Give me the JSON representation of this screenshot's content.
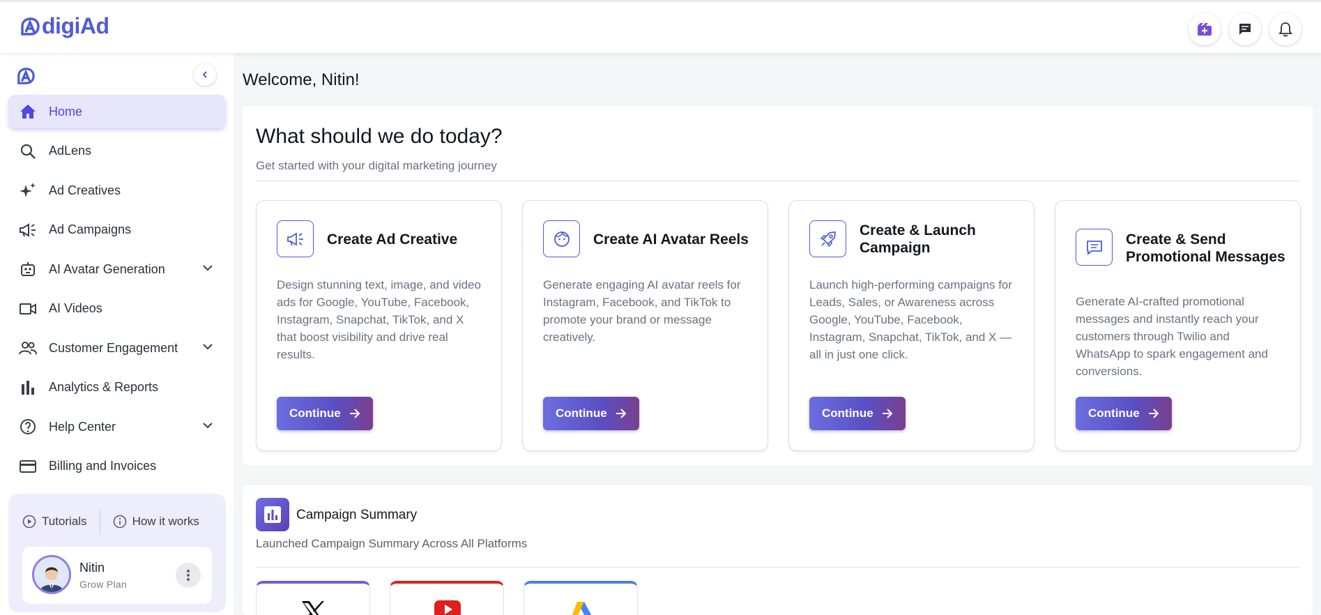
{
  "header": {
    "logo_text": "digiAd",
    "brand_color": "#4f5bd5",
    "icons": [
      "video-add-icon",
      "chat-icon",
      "bell-icon"
    ]
  },
  "sidebar": {
    "items": [
      {
        "label": "Home",
        "icon": "home-icon",
        "active": true
      },
      {
        "label": "AdLens",
        "icon": "search-icon"
      },
      {
        "label": "Ad Creatives",
        "icon": "sparkle-icon"
      },
      {
        "label": "Ad Campaigns",
        "icon": "megaphone-icon"
      },
      {
        "label": "AI Avatar Generation",
        "icon": "robot-icon",
        "expandable": true
      },
      {
        "label": "AI Videos",
        "icon": "video-icon"
      },
      {
        "label": "Customer Engagement",
        "icon": "people-icon",
        "expandable": true
      },
      {
        "label": "Analytics & Reports",
        "icon": "bar-chart-icon"
      },
      {
        "label": "Help Center",
        "icon": "help-icon",
        "expandable": true
      },
      {
        "label": "Billing and Invoices",
        "icon": "card-icon"
      }
    ],
    "tutorials_label": "Tutorials",
    "how_it_works_label": "How it works",
    "user": {
      "name": "Nitin",
      "plan": "Grow Plan"
    }
  },
  "main": {
    "welcome": "Welcome, Nitin!",
    "panel_title": "What should we do today?",
    "panel_subtitle": "Get started with your digital marketing journey",
    "cards": [
      {
        "title": "Create Ad Creative",
        "icon": "megaphone-icon",
        "desc": "Design stunning text, image, and video ads for Google, YouTube, Facebook, Instagram, Snapchat, TikTok, and X that boost visibility and drive real results.",
        "button": "Continue"
      },
      {
        "title": "Create AI Avatar Reels",
        "icon": "face-icon",
        "desc": "Generate engaging AI avatar reels for Instagram, Facebook, and TikTok to promote your brand or message creatively.",
        "button": "Continue"
      },
      {
        "title": "Create & Launch Campaign",
        "icon": "rocket-icon",
        "desc": "Launch high-performing campaigns for Leads, Sales, or Awareness across Google, YouTube, Facebook, Instagram, Snapchat, TikTok, and X — all in just one click.",
        "button": "Continue"
      },
      {
        "title": "Create & Send Promotional Messages",
        "icon": "message-icon",
        "desc": "Generate AI-crafted promotional messages and instantly reach your customers through Twilio and WhatsApp to spark engagement and conversions.",
        "button": "Continue"
      }
    ],
    "summary": {
      "title": "Campaign Summary",
      "subtitle": "Launched Campaign Summary Across All Platforms",
      "platforms": [
        {
          "name": "x-logo-icon",
          "accent": "#6b5fd8"
        },
        {
          "name": "youtube-logo-icon",
          "accent": "#e01e1e"
        },
        {
          "name": "google-ads-logo-icon",
          "accent": "#4a7ee0"
        }
      ]
    }
  }
}
